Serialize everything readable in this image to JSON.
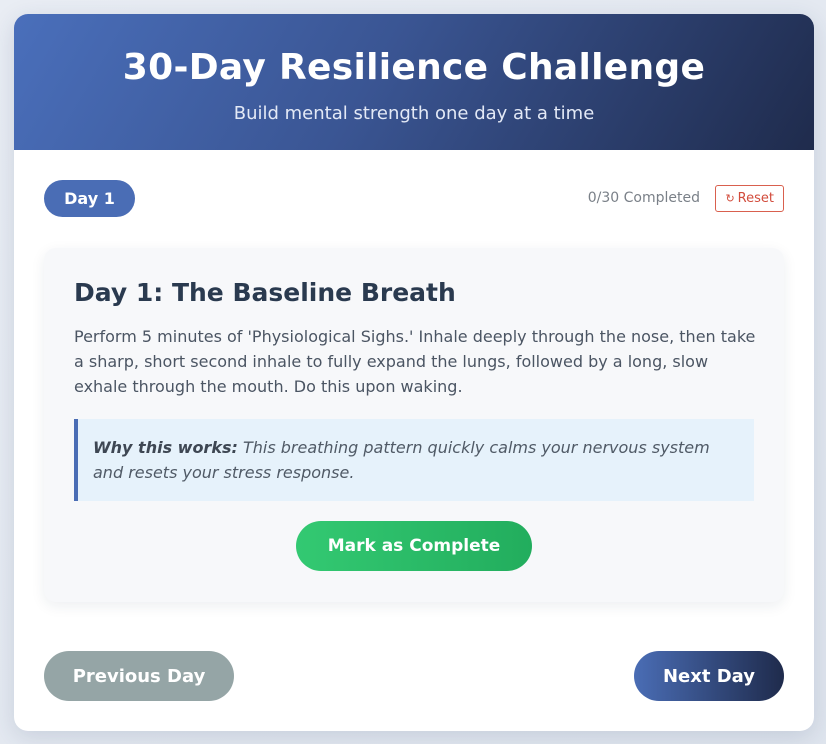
{
  "header": {
    "title": "30-Day Resilience Challenge",
    "subtitle": "Build mental strength one day at a time"
  },
  "toolbar": {
    "day_badge": "Day 1",
    "progress_text": "0/30 Completed",
    "reset_icon": "↻",
    "reset_label": "Reset"
  },
  "task": {
    "title": "Day 1: The Baseline Breath",
    "description": "Perform 5 minutes of 'Physiological Sighs.' Inhale deeply through the nose, then take a sharp, short second inhale to fully expand the lungs, followed by a long, slow exhale through the mouth. Do this upon waking.",
    "why_label": "Why this works:",
    "why_text": "This breathing pattern quickly calms your nervous system and resets your stress response.",
    "complete_label": "Mark as Complete"
  },
  "nav": {
    "previous_label": "Previous Day",
    "next_label": "Next Day"
  },
  "colors": {
    "accent": "#4a6db5",
    "header_dark": "#1f2b4c",
    "success": "#2ecc71",
    "muted_button": "#95a5a6",
    "danger": "#d24c3c"
  }
}
